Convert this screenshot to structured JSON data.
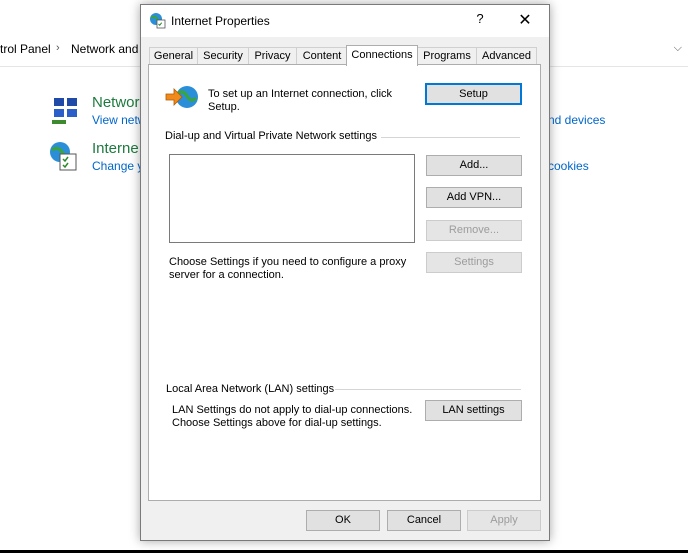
{
  "control_panel": {
    "breadcrumb": [
      "trol Panel",
      "Network and"
    ],
    "items": [
      {
        "title": "Networ",
        "link": "View netw",
        "link_right": "nd devices",
        "icon": "network-center-icon"
      },
      {
        "title": "Interne",
        "link": "Change y",
        "link_right": "cookies",
        "icon": "internet-options-icon"
      }
    ]
  },
  "dialog": {
    "title": "Internet Properties",
    "help_label": "?",
    "close_label": "✕",
    "tabs": [
      "General",
      "Security",
      "Privacy",
      "Content",
      "Connections",
      "Programs",
      "Advanced"
    ],
    "active_tab": "Connections",
    "setup_text": "To set up an Internet connection, click Setup.",
    "setup_button": "Setup",
    "dialup_group": "Dial-up and Virtual Private Network settings",
    "add_button": "Add...",
    "add_vpn_button": "Add VPN...",
    "remove_button": "Remove...",
    "settings_button": "Settings",
    "proxy_text": "Choose Settings if you need to configure a proxy server for a connection.",
    "lan_group": "Local Area Network (LAN) settings",
    "lan_text": "LAN Settings do not apply to dial-up connections. Choose Settings above for dial-up settings.",
    "lan_button": "LAN settings",
    "ok_button": "OK",
    "cancel_button": "Cancel",
    "apply_button": "Apply"
  }
}
